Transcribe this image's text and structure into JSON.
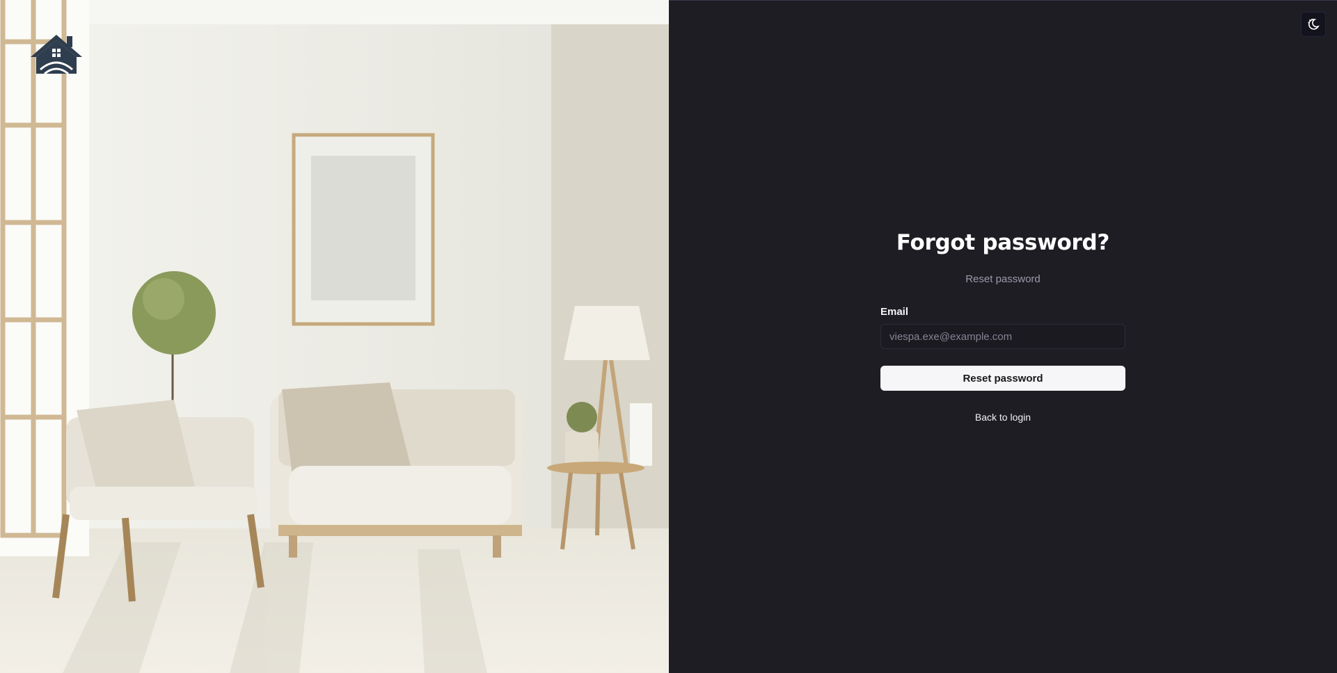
{
  "branding": {
    "logo_icon": "house-logo-icon"
  },
  "theme_toggle": {
    "icon": "moon-stars-icon"
  },
  "form": {
    "title": "Forgot password?",
    "subtitle": "Reset password",
    "email_label": "Email",
    "email_placeholder": "viespa.exe@example.com",
    "email_value": "",
    "submit_label": "Reset password",
    "back_link": "Back to login"
  },
  "colors": {
    "background": "#1e1d24",
    "button_bg": "#f6f6f8",
    "logo": "#2f3e4f"
  }
}
